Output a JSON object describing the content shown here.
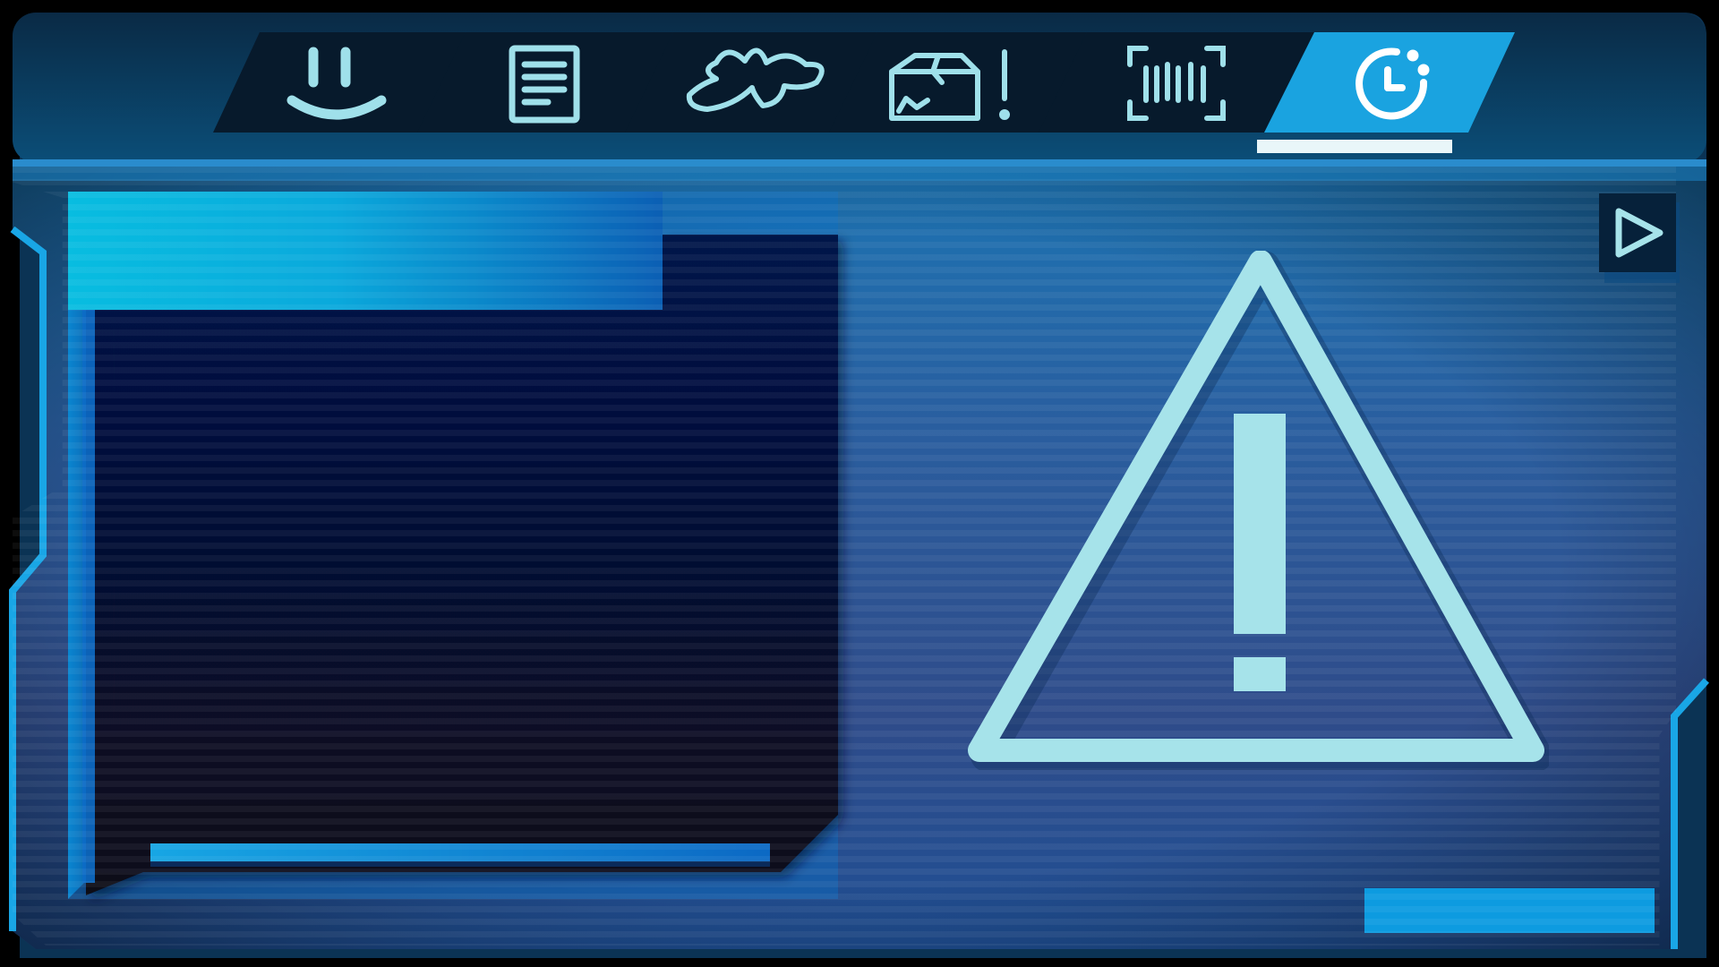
{
  "colors": {
    "accent": "#1aa3e0",
    "icon_inactive": "#9fe0ea",
    "icon_active": "#ffffff",
    "panel_dark": "#05102e",
    "warning": "#a6e3ea"
  },
  "tabs": [
    {
      "icon": "smile-icon",
      "active": false
    },
    {
      "icon": "document-icon",
      "active": false
    },
    {
      "icon": "splat-icon",
      "active": false
    },
    {
      "icon": "damaged-package-icon",
      "active": false
    },
    {
      "icon": "barcode-scan-icon",
      "active": false
    },
    {
      "icon": "clock-icon",
      "active": true
    }
  ],
  "play_button": {
    "icon": "play-icon"
  },
  "warning": {
    "icon": "warning-icon"
  }
}
